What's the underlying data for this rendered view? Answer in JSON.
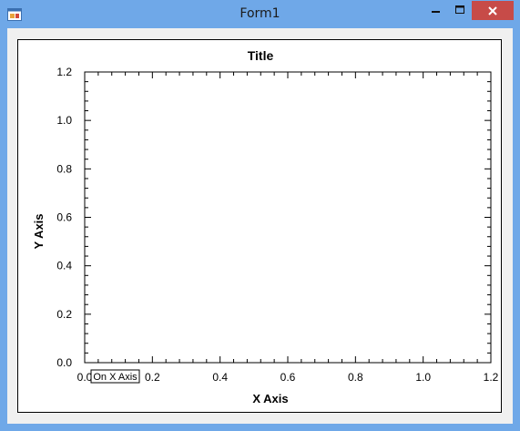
{
  "window": {
    "title": "Form1",
    "minimize_icon": "minimize-icon",
    "maximize_icon": "maximize-icon",
    "close_icon": "close-icon",
    "app_icon": "form-app-icon",
    "close_color": "#c74b48",
    "frame_color": "#6fa8e8"
  },
  "chart_data": {
    "type": "scatter",
    "title": "Title",
    "xlabel": "X Axis",
    "ylabel": "Y Axis",
    "xlim": [
      0.0,
      1.2
    ],
    "ylim": [
      0.0,
      1.2
    ],
    "x_ticks": [
      "0.0",
      "0.2",
      "0.4",
      "0.6",
      "0.8",
      "1.0",
      "1.2"
    ],
    "y_ticks": [
      "0.0",
      "0.2",
      "0.4",
      "0.6",
      "0.8",
      "1.0",
      "1.2"
    ],
    "series": [],
    "grid": false,
    "annotation": "On X Axis"
  }
}
